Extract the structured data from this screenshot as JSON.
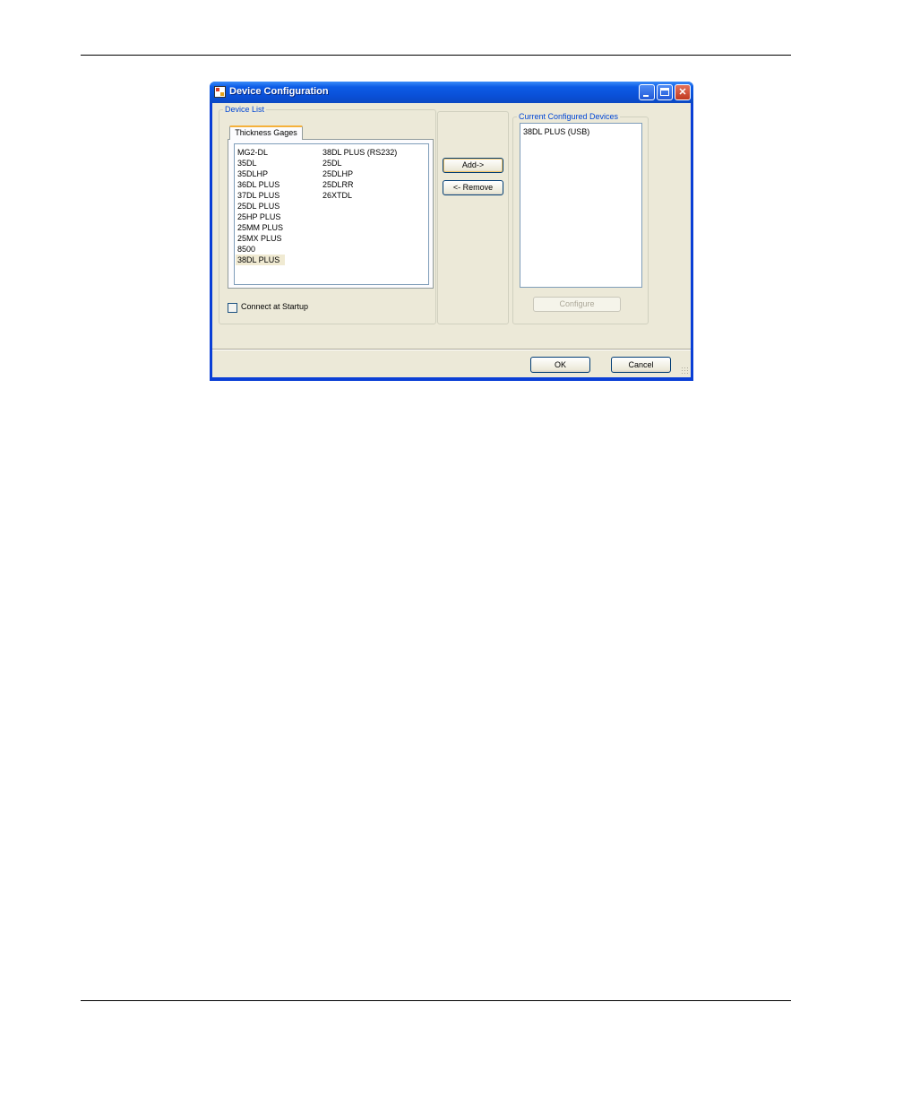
{
  "window": {
    "title": "Device Configuration",
    "minimize_label": "_",
    "maximize_label": "□",
    "close_label": "✕"
  },
  "device_list": {
    "group_label": "Device List",
    "tab_label": "Thickness Gages",
    "column1": [
      "MG2-DL",
      "35DL",
      "35DLHP",
      "36DL PLUS",
      "37DL PLUS",
      "25DL PLUS",
      "25HP PLUS",
      "25MM PLUS",
      "25MX PLUS",
      "8500",
      "38DL PLUS"
    ],
    "column2": [
      "38DL PLUS (RS232)",
      "25DL",
      "25DLHP",
      "25DLRR",
      "26XTDL"
    ],
    "selected_item": "38DL PLUS",
    "connect_checkbox_label": "Connect at Startup",
    "connect_checked": false
  },
  "actions": {
    "add_label": "Add->",
    "remove_label": "<- Remove"
  },
  "configured": {
    "group_label": "Current Configured Devices",
    "items": [
      "38DL PLUS (USB)"
    ],
    "configure_label": "Configure"
  },
  "footer": {
    "ok_label": "OK",
    "cancel_label": "Cancel"
  },
  "icons": {
    "app": "app-icon",
    "minimize": "minimize-icon",
    "maximize": "maximize-icon",
    "close": "close-icon"
  }
}
